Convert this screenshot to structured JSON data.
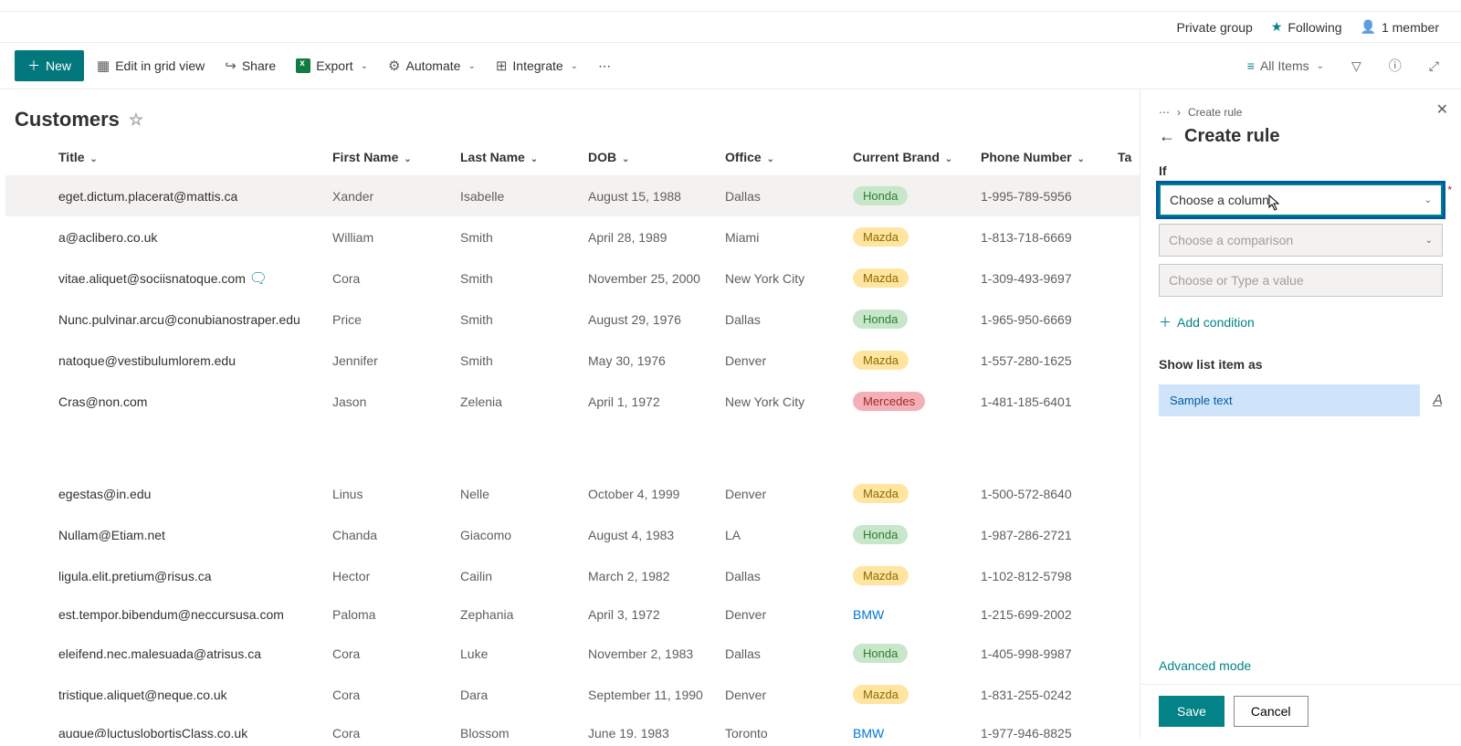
{
  "header": {
    "privacy": "Private group",
    "following": "Following",
    "members": "1 member"
  },
  "toolbar": {
    "new": "New",
    "editGrid": "Edit in grid view",
    "share": "Share",
    "export": "Export",
    "automate": "Automate",
    "integrate": "Integrate",
    "allItems": "All Items"
  },
  "list": {
    "title": "Customers",
    "columns": {
      "title": "Title",
      "firstName": "First Name",
      "lastName": "Last Name",
      "dob": "DOB",
      "office": "Office",
      "brand": "Current Brand",
      "phone": "Phone Number",
      "ta": "Ta"
    },
    "rows": [
      {
        "title": "eget.dictum.placerat@mattis.ca",
        "fn": "Xander",
        "ln": "Isabelle",
        "dob": "August 15, 1988",
        "off": "Dallas",
        "brand": "Honda",
        "phone": "1-995-789-5956",
        "zebra": true
      },
      {
        "title": "a@aclibero.co.uk",
        "fn": "William",
        "ln": "Smith",
        "dob": "April 28, 1989",
        "off": "Miami",
        "brand": "Mazda",
        "phone": "1-813-718-6669",
        "zebra": false
      },
      {
        "title": "vitae.aliquet@sociisnatoque.com",
        "fn": "Cora",
        "ln": "Smith",
        "dob": "November 25, 2000",
        "off": "New York City",
        "brand": "Mazda",
        "phone": "1-309-493-9697",
        "zebra": false,
        "comment": true
      },
      {
        "title": "Nunc.pulvinar.arcu@conubianostraper.edu",
        "fn": "Price",
        "ln": "Smith",
        "dob": "August 29, 1976",
        "off": "Dallas",
        "brand": "Honda",
        "phone": "1-965-950-6669",
        "zebra": false
      },
      {
        "title": "natoque@vestibulumlorem.edu",
        "fn": "Jennifer",
        "ln": "Smith",
        "dob": "May 30, 1976",
        "off": "Denver",
        "brand": "Mazda",
        "phone": "1-557-280-1625",
        "zebra": false
      },
      {
        "title": "Cras@non.com",
        "fn": "Jason",
        "ln": "Zelenia",
        "dob": "April 1, 1972",
        "off": "New York City",
        "brand": "Mercedes",
        "phone": "1-481-185-6401",
        "zebra": false
      },
      {
        "gap": true
      },
      {
        "title": "egestas@in.edu",
        "fn": "Linus",
        "ln": "Nelle",
        "dob": "October 4, 1999",
        "off": "Denver",
        "brand": "Mazda",
        "phone": "1-500-572-8640",
        "zebra": false
      },
      {
        "title": "Nullam@Etiam.net",
        "fn": "Chanda",
        "ln": "Giacomo",
        "dob": "August 4, 1983",
        "off": "LA",
        "brand": "Honda",
        "phone": "1-987-286-2721",
        "zebra": false
      },
      {
        "title": "ligula.elit.pretium@risus.ca",
        "fn": "Hector",
        "ln": "Cailin",
        "dob": "March 2, 1982",
        "off": "Dallas",
        "brand": "Mazda",
        "phone": "1-102-812-5798",
        "zebra": false
      },
      {
        "title": "est.tempor.bibendum@neccursusa.com",
        "fn": "Paloma",
        "ln": "Zephania",
        "dob": "April 3, 1972",
        "off": "Denver",
        "brand": "BMW",
        "phone": "1-215-699-2002",
        "zebra": false
      },
      {
        "title": "eleifend.nec.malesuada@atrisus.ca",
        "fn": "Cora",
        "ln": "Luke",
        "dob": "November 2, 1983",
        "off": "Dallas",
        "brand": "Honda",
        "phone": "1-405-998-9987",
        "zebra": false
      },
      {
        "title": "tristique.aliquet@neque.co.uk",
        "fn": "Cora",
        "ln": "Dara",
        "dob": "September 11, 1990",
        "off": "Denver",
        "brand": "Mazda",
        "phone": "1-831-255-0242",
        "zebra": false
      },
      {
        "title": "augue@luctuslobortisClass.co.uk",
        "fn": "Cora",
        "ln": "Blossom",
        "dob": "June 19, 1983",
        "off": "Toronto",
        "brand": "BMW",
        "phone": "1-977-946-8825",
        "zebra": false
      }
    ]
  },
  "panel": {
    "breadcrumb": "Create rule",
    "title": "Create rule",
    "if": "If",
    "chooseColumn": "Choose a column",
    "chooseComparison": "Choose a comparison",
    "chooseValue": "Choose or Type a value",
    "addCondition": "Add condition",
    "showAs": "Show list item as",
    "sample": "Sample text",
    "advanced": "Advanced mode",
    "save": "Save",
    "cancel": "Cancel"
  }
}
